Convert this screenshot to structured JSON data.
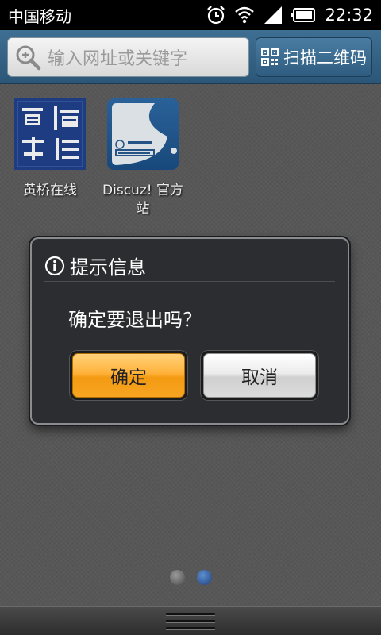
{
  "status_bar": {
    "carrier": "中国移动",
    "time": "22:32"
  },
  "search": {
    "placeholder": "输入网址或关键字"
  },
  "scan_button": {
    "label": "扫描二维码"
  },
  "apps": [
    {
      "label": "黄桥在线",
      "icon": "huangqiao-logo"
    },
    {
      "label": "Discuz! 官方站",
      "icon": "discuz-logo"
    }
  ],
  "dialog": {
    "title": "提示信息",
    "message": "确定要退出吗？",
    "confirm_label": "确定",
    "cancel_label": "取消"
  },
  "page_indicator": {
    "total": 2,
    "active": 2
  },
  "colors": {
    "accent_orange": "#ffb23a",
    "topbar_blue": "#2f5c80",
    "dialog_bg": "#2b2d30"
  }
}
